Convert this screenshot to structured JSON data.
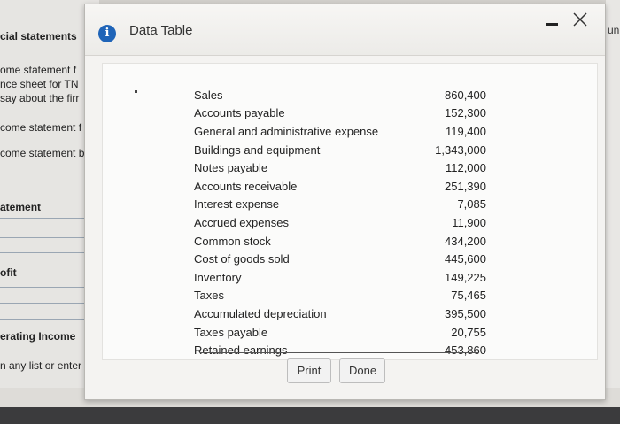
{
  "background": {
    "items": [
      {
        "text": "cial statements",
        "bold": true
      },
      {
        "text": "ome statement f",
        "bold": false
      },
      {
        "text": "nce sheet for TN",
        "bold": false
      },
      {
        "text": "say about the firr",
        "bold": false
      },
      {
        "text": "come statement f",
        "bold": false
      },
      {
        "text": "come statement b",
        "bold": false
      },
      {
        "text": "atement",
        "bold": true
      },
      {
        "text": "ofit",
        "bold": true
      },
      {
        "text": "erating Income",
        "bold": true
      },
      {
        "text": "n any list or enter an",
        "bold": false
      }
    ],
    "top_right": "un"
  },
  "dialog": {
    "title": "Data Table",
    "info_icon": "info-icon",
    "minimize_icon": "minimize-icon",
    "close_icon": "close-icon",
    "rows": [
      {
        "label": "Sales",
        "value": "860,400"
      },
      {
        "label": "Accounts payable",
        "value": "152,300"
      },
      {
        "label": "General and administrative expense",
        "value": "119,400"
      },
      {
        "label": "Buildings and equipment",
        "value": "1,343,000"
      },
      {
        "label": "Notes payable",
        "value": "112,000"
      },
      {
        "label": "Accounts receivable",
        "value": "251,390"
      },
      {
        "label": "Interest expense",
        "value": "7,085"
      },
      {
        "label": "Accrued expenses",
        "value": "11,900"
      },
      {
        "label": "Common stock",
        "value": "434,200"
      },
      {
        "label": "Cost of goods sold",
        "value": "445,600"
      },
      {
        "label": "Inventory",
        "value": "149,225"
      },
      {
        "label": "Taxes",
        "value": "75,465"
      },
      {
        "label": "Accumulated depreciation",
        "value": "395,500"
      },
      {
        "label": "Taxes payable",
        "value": "20,755"
      },
      {
        "label": "Retained earnings",
        "value": "453,860"
      }
    ],
    "print_label": "Print",
    "done_label": "Done"
  },
  "colors": {
    "info_icon": "#1f64b8",
    "taskbar": "#3b3b3d"
  }
}
